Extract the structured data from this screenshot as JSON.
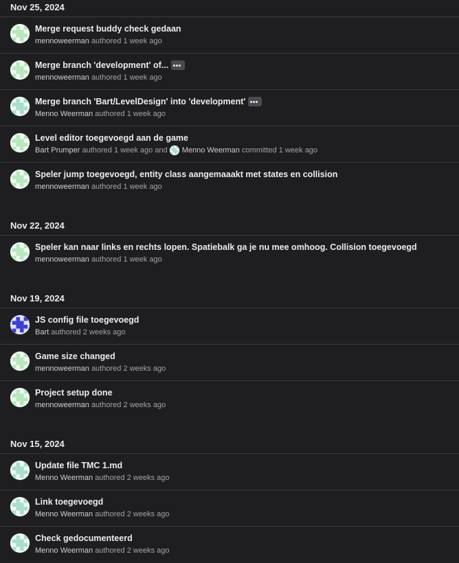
{
  "groups": [
    {
      "date": "Nov 25, 2024",
      "commits": [
        {
          "title": "Merge request buddy check gedaan",
          "author": "mennoweerman",
          "action": "authored",
          "time": "1 week ago",
          "avatar": "green"
        },
        {
          "title": "Merge branch 'development' of...",
          "author": "mennoweerman",
          "action": "authored",
          "time": "1 week ago",
          "avatar": "green",
          "ellipsis": true
        },
        {
          "title": "Merge branch 'Bart/LevelDesign' into 'development'",
          "author": "Menno Weerman",
          "action": "authored",
          "time": "1 week ago",
          "avatar": "teal",
          "ellipsis": true
        },
        {
          "title": "Level editor toegevoegd aan de game",
          "author": "Bart Prumper",
          "action": "authored",
          "time": "1 week ago",
          "avatar": "green",
          "joiner": "and",
          "committer": "Menno Weerman",
          "committer_action": "committed",
          "committer_time": "1 week ago"
        },
        {
          "title": "Speler jump toegevoegd, entity class aangemaaakt met states en collision",
          "author": "mennoweerman",
          "action": "authored",
          "time": "1 week ago",
          "avatar": "green"
        }
      ]
    },
    {
      "date": "Nov 22, 2024",
      "commits": [
        {
          "title": "Speler kan naar links en rechts lopen. Spatiebalk ga je nu mee omhoog. Collision toegevoegd",
          "author": "mennoweerman",
          "action": "authored",
          "time": "1 week ago",
          "avatar": "green"
        }
      ]
    },
    {
      "date": "Nov 19, 2024",
      "commits": [
        {
          "title": "JS config file toegevoegd",
          "author": "Bart",
          "action": "authored",
          "time": "2 weeks ago",
          "avatar": "blue"
        },
        {
          "title": "Game size changed",
          "author": "mennoweerman",
          "action": "authored",
          "time": "2 weeks ago",
          "avatar": "green"
        },
        {
          "title": "Project setup done",
          "author": "mennoweerman",
          "action": "authored",
          "time": "2 weeks ago",
          "avatar": "green"
        }
      ]
    },
    {
      "date": "Nov 15, 2024",
      "commits": [
        {
          "title": "Update file TMC 1.md",
          "author": "Menno Weerman",
          "action": "authored",
          "time": "2 weeks ago",
          "avatar": "teal"
        },
        {
          "title": "Link toegevoegd",
          "author": "Menno Weerman",
          "action": "authored",
          "time": "2 weeks ago",
          "avatar": "teal"
        },
        {
          "title": "Check gedocumenteerd",
          "author": "Menno Weerman",
          "action": "authored",
          "time": "2 weeks ago",
          "avatar": "teal"
        }
      ]
    }
  ],
  "colors": {
    "background": "#1e1e20",
    "divider": "#3a383f",
    "avatar_green": "#b9e6bf",
    "avatar_teal": "#a9ddd0",
    "avatar_blue": "#3b3fd6"
  },
  "icons": {
    "ellipsis": "horizontal-ellipsis-icon",
    "avatar": "identicon-avatar"
  }
}
